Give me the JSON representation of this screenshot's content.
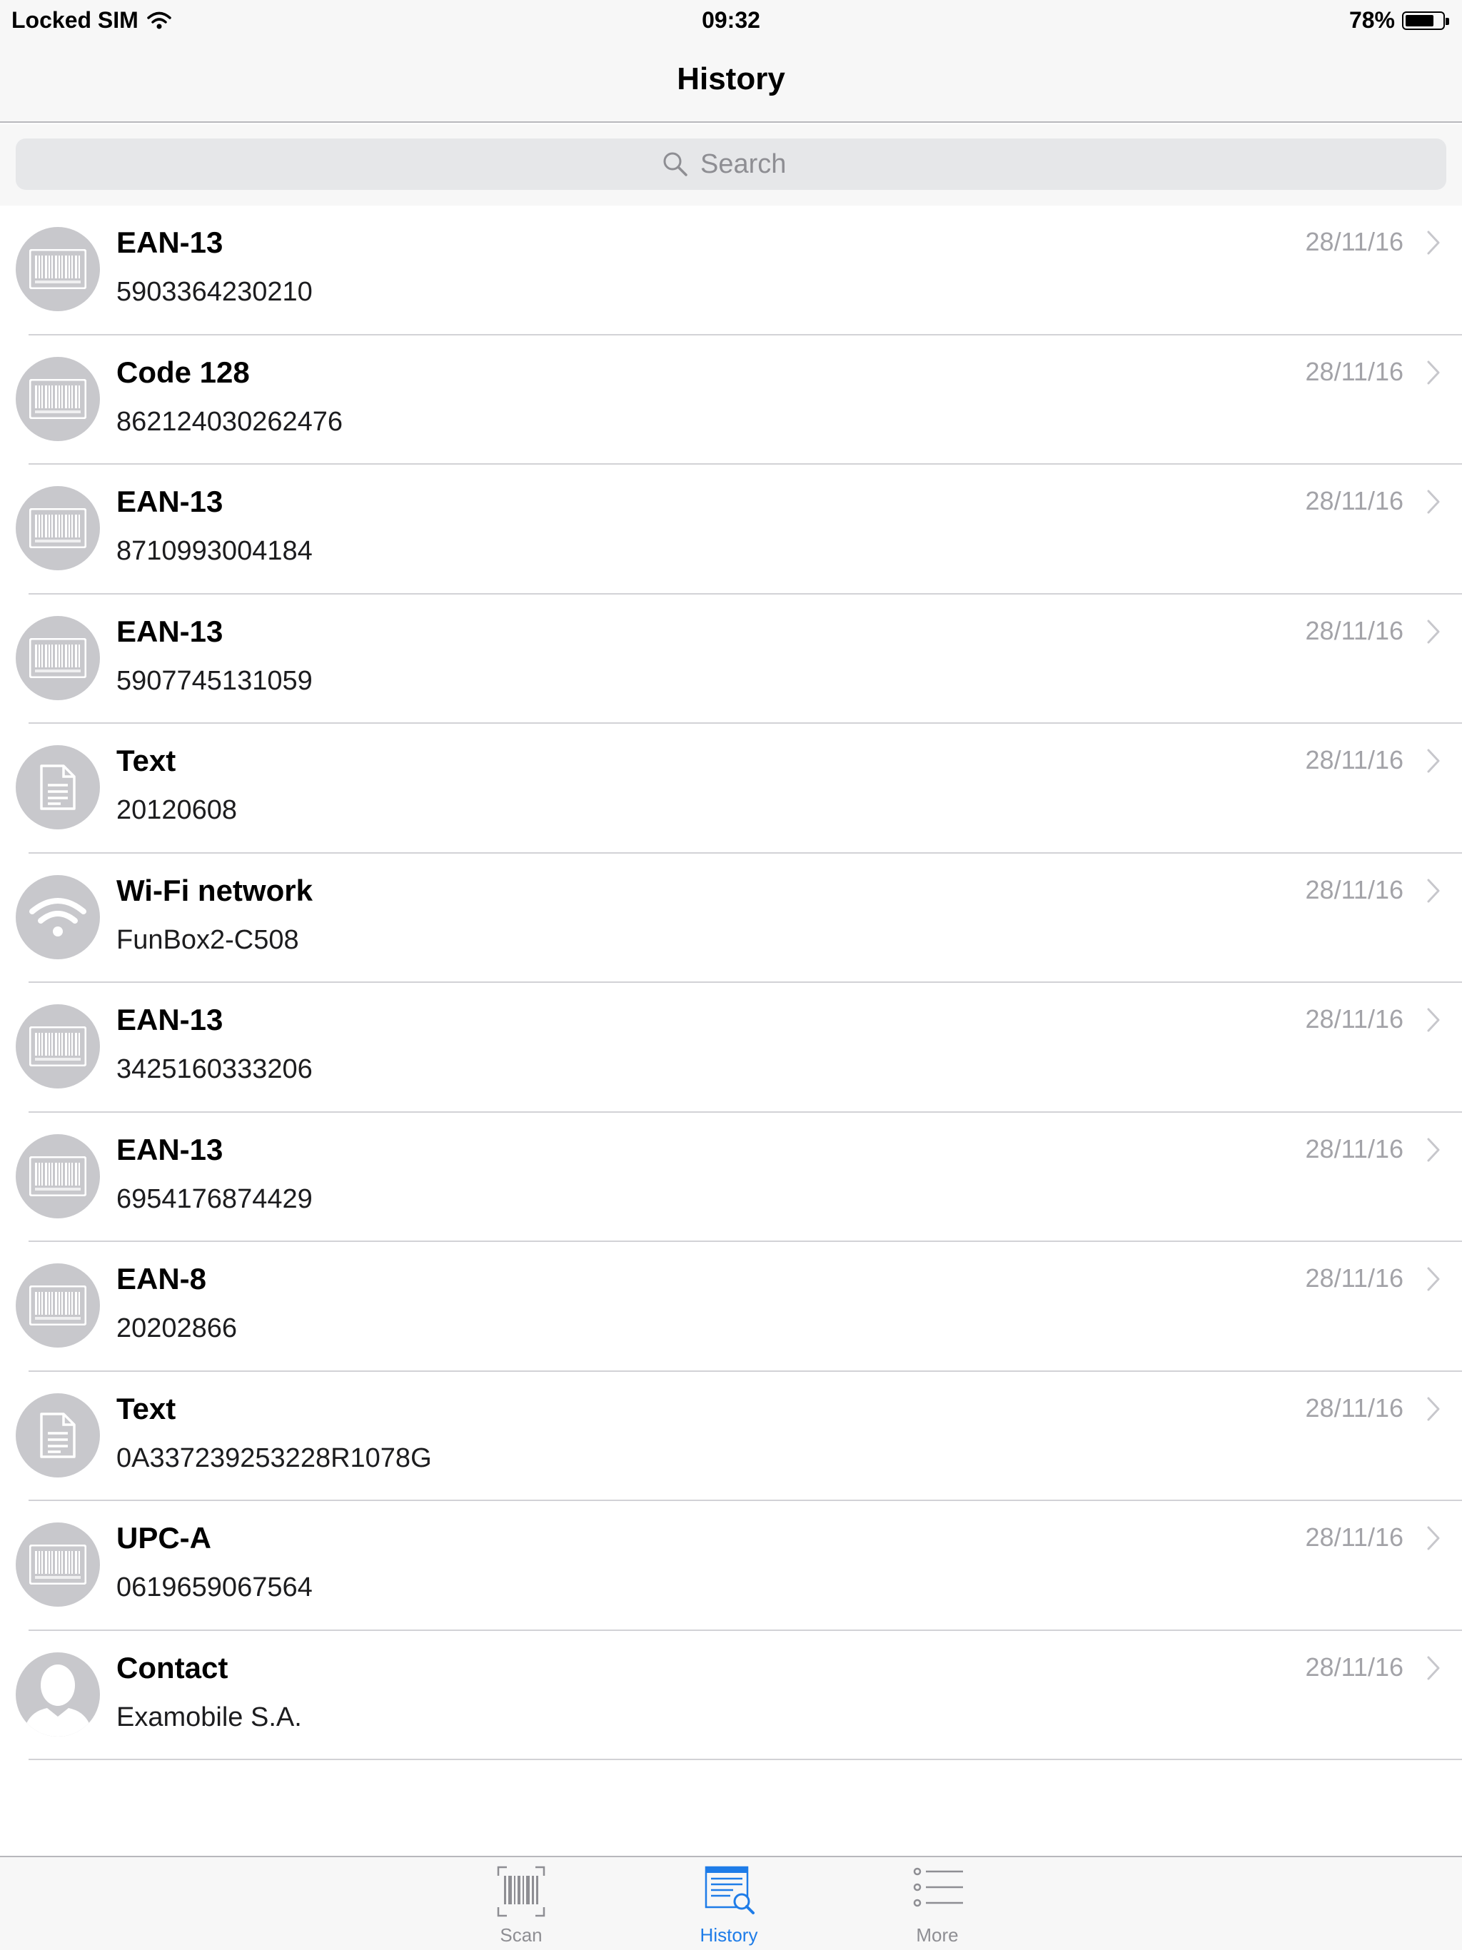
{
  "status_bar": {
    "carrier": "Locked SIM",
    "time": "09:32",
    "battery_percent": "78%",
    "battery_level": 0.78
  },
  "nav": {
    "title": "History"
  },
  "search": {
    "placeholder": "Search",
    "icon": "search-icon"
  },
  "history_items": [
    {
      "type": "EAN-13",
      "value": "5903364230210",
      "date": "28/11/16",
      "icon": "barcode"
    },
    {
      "type": "Code 128",
      "value": "862124030262476",
      "date": "28/11/16",
      "icon": "barcode"
    },
    {
      "type": "EAN-13",
      "value": "8710993004184",
      "date": "28/11/16",
      "icon": "barcode"
    },
    {
      "type": "EAN-13",
      "value": "5907745131059",
      "date": "28/11/16",
      "icon": "barcode"
    },
    {
      "type": "Text",
      "value": "20120608",
      "date": "28/11/16",
      "icon": "document"
    },
    {
      "type": "Wi-Fi network",
      "value": "FunBox2-C508",
      "date": "28/11/16",
      "icon": "wifi"
    },
    {
      "type": "EAN-13",
      "value": "3425160333206",
      "date": "28/11/16",
      "icon": "barcode"
    },
    {
      "type": "EAN-13",
      "value": "6954176874429",
      "date": "28/11/16",
      "icon": "barcode"
    },
    {
      "type": "EAN-8",
      "value": "20202866",
      "date": "28/11/16",
      "icon": "barcode"
    },
    {
      "type": "Text",
      "value": "0A337239253228R1078G",
      "date": "28/11/16",
      "icon": "document"
    },
    {
      "type": "UPC-A",
      "value": "0619659067564",
      "date": "28/11/16",
      "icon": "barcode"
    },
    {
      "type": "Contact",
      "value": "Examobile S.A.",
      "date": "28/11/16",
      "icon": "person"
    }
  ],
  "tab_bar": {
    "tabs": [
      {
        "label": "Scan",
        "icon": "barcode-scan-icon",
        "active": false
      },
      {
        "label": "History",
        "icon": "history-icon",
        "active": true
      },
      {
        "label": "More",
        "icon": "more-list-icon",
        "active": false
      }
    ]
  },
  "colors": {
    "accent": "#1e7ce8",
    "icon_circle": "#c8c8cc",
    "secondary_text": "#a3a3a8",
    "bar_background": "#f7f7f7"
  }
}
